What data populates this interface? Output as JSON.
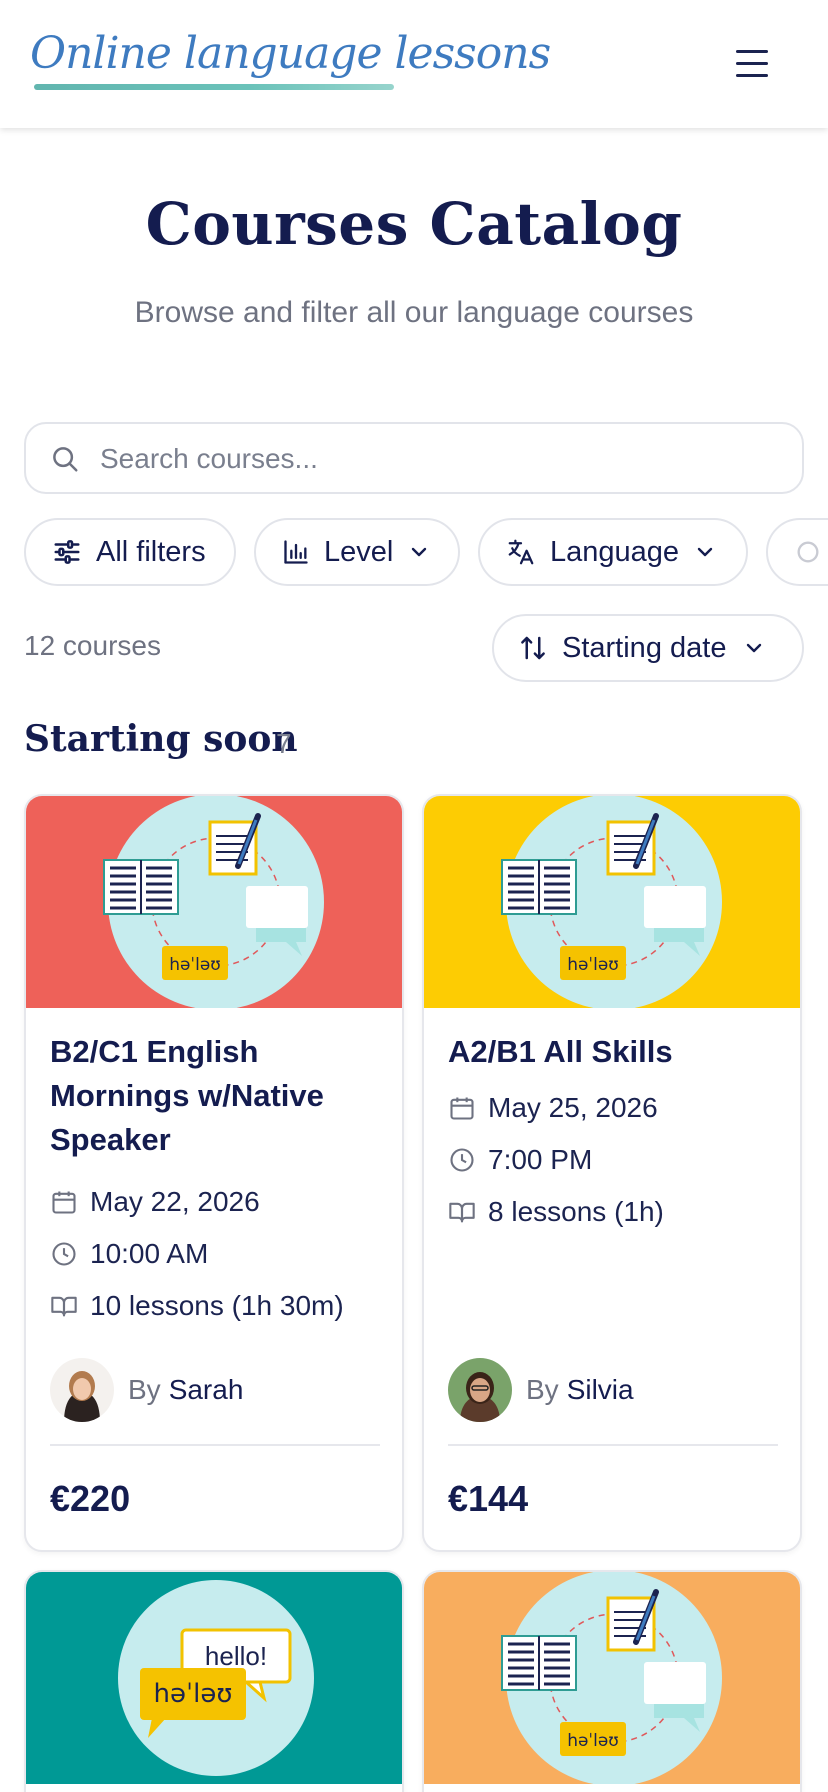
{
  "header": {
    "logo_text": "Online language lessons",
    "menu_icon": "hamburger-menu-icon"
  },
  "page": {
    "title": "Courses Catalog",
    "subtitle": "Browse and filter all our language courses"
  },
  "search": {
    "placeholder": "Search courses...",
    "value": ""
  },
  "filters": {
    "all_filters": "All filters",
    "level": "Level",
    "language": "Language"
  },
  "results": {
    "count_text": "12 courses",
    "sort_label": "Starting date"
  },
  "section": {
    "title": "Starting soon",
    "count": "7"
  },
  "courses": [
    {
      "title": "B2/C1 English Mornings w/Native Speaker",
      "date": "May 22, 2026",
      "time": "10:00 AM",
      "lessons": "10 lessons (1h 30m)",
      "by_label": "By",
      "teacher": "Sarah",
      "price": "€220",
      "banner_color": "#ee6159",
      "banner_badge": "həˈləʊ"
    },
    {
      "title": "A2/B1 All Skills",
      "date": "May 25, 2026",
      "time": "7:00 PM",
      "lessons": "8 lessons (1h)",
      "by_label": "By",
      "teacher": "Silvia",
      "price": "€144",
      "banner_color": "#fdcc03",
      "banner_badge": "həˈləʊ"
    },
    {
      "banner_color": "#009995",
      "bubble_text": "hello!",
      "banner_badge": "həˈləʊ"
    },
    {
      "banner_color": "#f8ad5e",
      "banner_badge": "həˈləʊ"
    }
  ],
  "colors": {
    "navy": "#141c4f",
    "muted": "#6e7281",
    "logo_blue": "#3e7bc0",
    "circle": "#c6ecee"
  }
}
